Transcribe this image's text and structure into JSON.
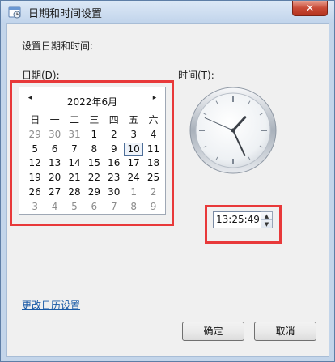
{
  "window": {
    "title": "日期和时间设置",
    "close_label": "✕"
  },
  "main": {
    "prompt": "设置日期和时间:",
    "date_label": "日期(D):",
    "time_label": "时间(T):"
  },
  "calendar": {
    "month_title": "2022年6月",
    "prev_glyph": "◂",
    "next_glyph": "▸",
    "weekdays": [
      "日",
      "一",
      "二",
      "三",
      "四",
      "五",
      "六"
    ],
    "weeks": [
      [
        "29",
        "30",
        "31",
        "1",
        "2",
        "3",
        "4"
      ],
      [
        "5",
        "6",
        "7",
        "8",
        "9",
        "10",
        "11"
      ],
      [
        "12",
        "13",
        "14",
        "15",
        "16",
        "17",
        "18"
      ],
      [
        "19",
        "20",
        "21",
        "22",
        "23",
        "24",
        "25"
      ],
      [
        "26",
        "27",
        "28",
        "29",
        "30",
        "1",
        "2"
      ],
      [
        "3",
        "4",
        "5",
        "6",
        "7",
        "8",
        "9"
      ]
    ],
    "selected_day": "10"
  },
  "clock": {
    "hour": 13,
    "minute": 25,
    "second": 49
  },
  "time_field": {
    "value": "13:25:49",
    "up_glyph": "▲",
    "down_glyph": "▼"
  },
  "footer": {
    "calendar_link": "更改日历设置",
    "ok_label": "确定",
    "cancel_label": "取消"
  },
  "colors": {
    "highlight": "#e8393a",
    "link": "#1a5aa6",
    "title_bar": "#c1d4eb"
  }
}
